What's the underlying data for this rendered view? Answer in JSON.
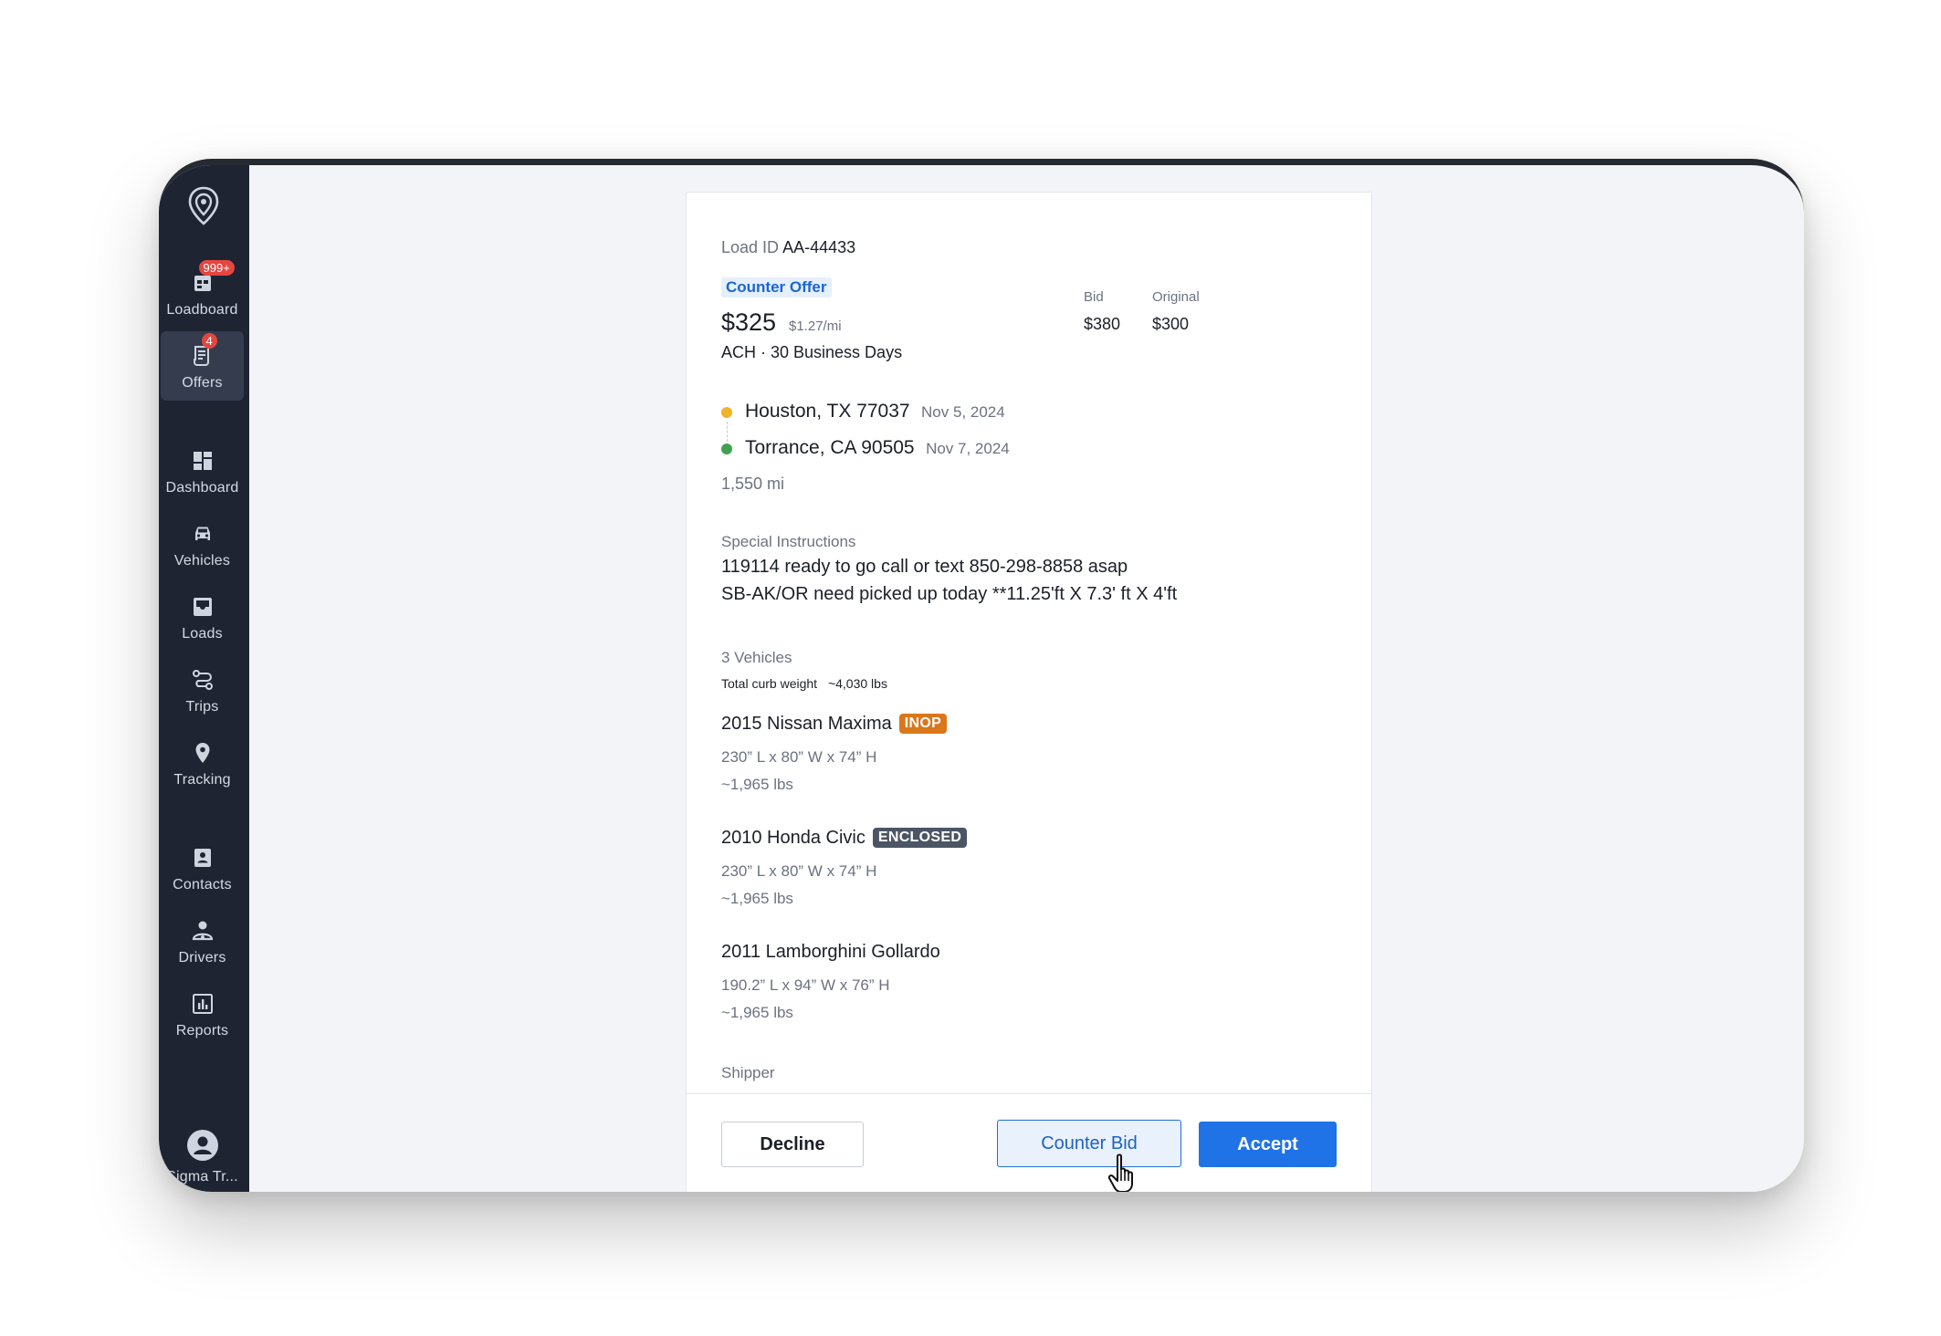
{
  "nav": {
    "loadboard": {
      "label": "Loadboard",
      "badge": "999+"
    },
    "offers": {
      "label": "Offers",
      "badge": "4"
    },
    "dashboard": {
      "label": "Dashboard"
    },
    "vehicles": {
      "label": "Vehicles"
    },
    "loads": {
      "label": "Loads"
    },
    "trips": {
      "label": "Trips"
    },
    "tracking": {
      "label": "Tracking"
    },
    "contacts": {
      "label": "Contacts"
    },
    "drivers": {
      "label": "Drivers"
    },
    "reports": {
      "label": "Reports"
    },
    "account": {
      "label": "Sigma Tr..."
    }
  },
  "offer": {
    "load_id_label": "Load ID",
    "load_id": "AA-44433",
    "status_tag": "Counter Offer",
    "price": "$325",
    "per_mile": "$1.27/mi",
    "payment_terms": "ACH · 30 Business Days",
    "bid_label": "Bid",
    "bid_value": "$380",
    "original_label": "Original",
    "original_value": "$300",
    "colors": {
      "accent": "#1f73e6",
      "tag_bg": "#e6f0fd",
      "pickup_dot": "#f0b429",
      "delivery_dot": "#3fa34d",
      "inop": "#d9771a",
      "enclosed": "#4b5563"
    }
  },
  "route": {
    "pickup": {
      "location": "Houston, TX 77037",
      "date": "Nov 5, 2024"
    },
    "delivery": {
      "location": "Torrance, CA 90505",
      "date": "Nov 7, 2024"
    },
    "distance": "1,550 mi"
  },
  "instructions": {
    "label": "Special Instructions",
    "line1": "119114 ready to go call or text 850-298-8858 asap",
    "line2": "SB-AK/OR need picked up today **11.25'ft X 7.3' ft X 4'ft"
  },
  "vehicles": {
    "count_label": "3 Vehicles",
    "curb_weight_label": "Total curb weight",
    "curb_weight_value": "~4,030 lbs",
    "items": [
      {
        "name": "2015 Nissan Maxima",
        "tag": "INOP",
        "dims": "230” L x 80” W x 74” H",
        "weight": "~1,965 lbs"
      },
      {
        "name": "2010 Honda Civic",
        "tag": "ENCLOSED",
        "dims": "230” L x 80” W x 74” H",
        "weight": "~1,965 lbs"
      },
      {
        "name": "2011 Lamborghini Gollardo",
        "tag": "",
        "dims": "190.2” L x 94” W x 76” H",
        "weight": "~1,965 lbs"
      }
    ]
  },
  "shipper_label": "Shipper",
  "actions": {
    "decline": "Decline",
    "counter": "Counter Bid",
    "accept": "Accept"
  }
}
